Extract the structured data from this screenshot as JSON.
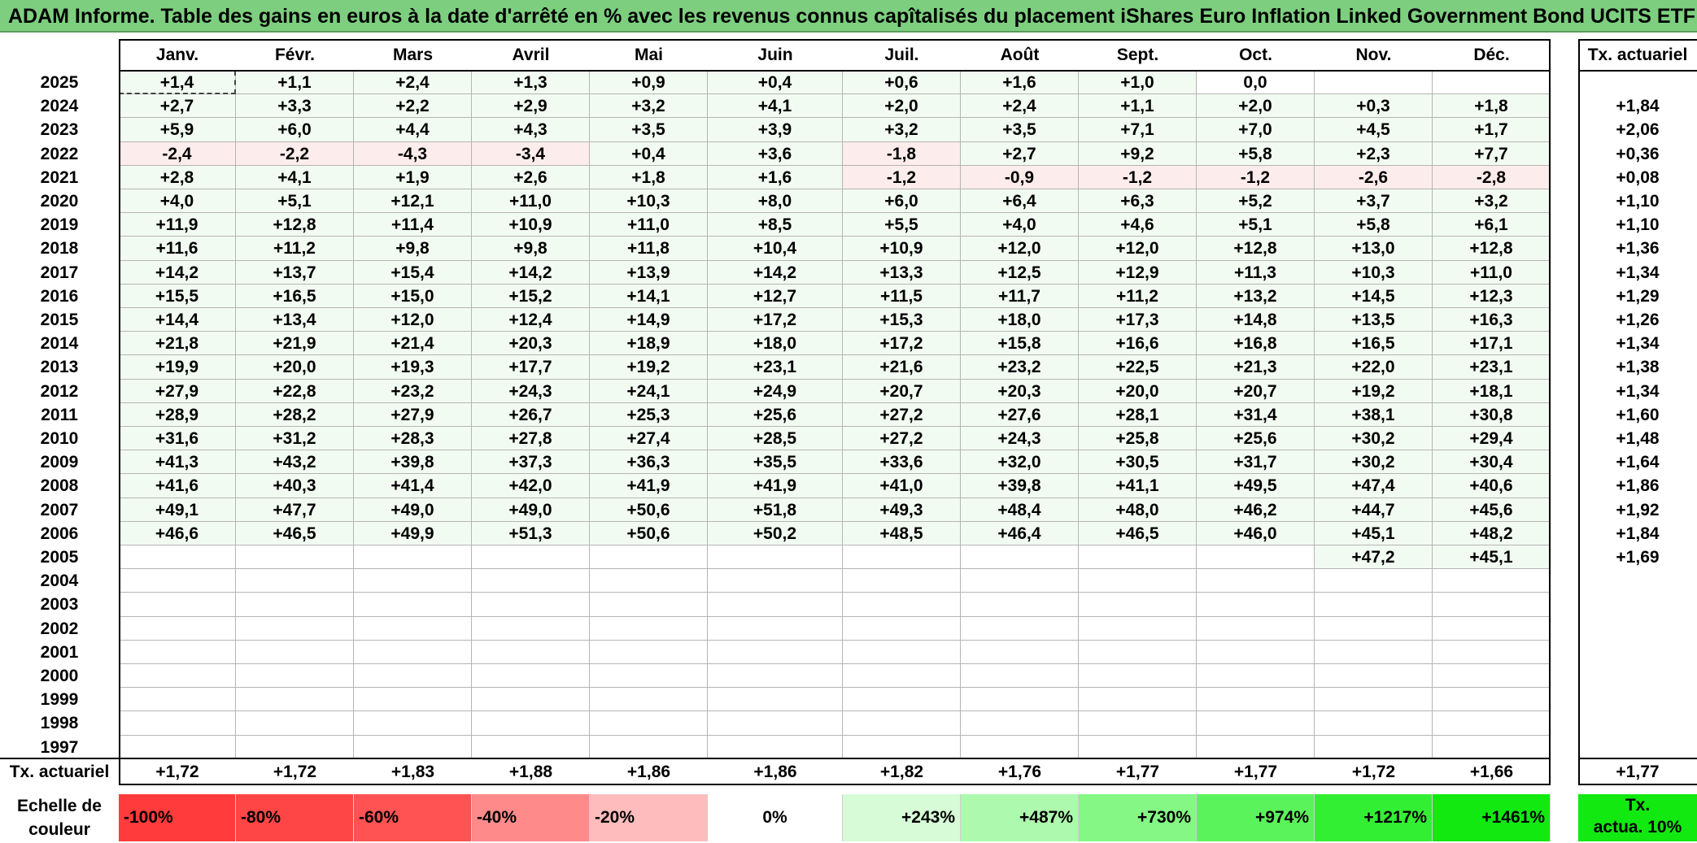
{
  "title": "ADAM Informe. Table des gains en euros à la date d'arrêté en % avec les revenus connus capîtalisés du placement iShares Euro Inflation Linked Government Bond UCITS ETF A",
  "months": [
    "Janv.",
    "Févr.",
    "Mars",
    "Avril",
    "Mai",
    "Juin",
    "Juil.",
    "Août",
    "Sept.",
    "Oct.",
    "Nov.",
    "Déc."
  ],
  "annual_header": "Tx. actuariel",
  "years": [
    "2025",
    "2024",
    "2023",
    "2022",
    "2021",
    "2020",
    "2019",
    "2018",
    "2017",
    "2016",
    "2015",
    "2014",
    "2013",
    "2012",
    "2011",
    "2010",
    "2009",
    "2008",
    "2007",
    "2006",
    "2005",
    "2004",
    "2003",
    "2002",
    "2001",
    "2000",
    "1999",
    "1998",
    "1997"
  ],
  "values": [
    [
      "+1,4",
      "+1,1",
      "+2,4",
      "+1,3",
      "+0,9",
      "+0,4",
      "+0,6",
      "+1,6",
      "+1,0",
      "0,0",
      "",
      ""
    ],
    [
      "+2,7",
      "+3,3",
      "+2,2",
      "+2,9",
      "+3,2",
      "+4,1",
      "+2,0",
      "+2,4",
      "+1,1",
      "+2,0",
      "+0,3",
      "+1,8"
    ],
    [
      "+5,9",
      "+6,0",
      "+4,4",
      "+4,3",
      "+3,5",
      "+3,9",
      "+3,2",
      "+3,5",
      "+7,1",
      "+7,0",
      "+4,5",
      "+1,7"
    ],
    [
      "-2,4",
      "-2,2",
      "-4,3",
      "-3,4",
      "+0,4",
      "+3,6",
      "-1,8",
      "+2,7",
      "+9,2",
      "+5,8",
      "+2,3",
      "+7,7"
    ],
    [
      "+2,8",
      "+4,1",
      "+1,9",
      "+2,6",
      "+1,8",
      "+1,6",
      "-1,2",
      "-0,9",
      "-1,2",
      "-1,2",
      "-2,6",
      "-2,8"
    ],
    [
      "+4,0",
      "+5,1",
      "+12,1",
      "+11,0",
      "+10,3",
      "+8,0",
      "+6,0",
      "+6,4",
      "+6,3",
      "+5,2",
      "+3,7",
      "+3,2"
    ],
    [
      "+11,9",
      "+12,8",
      "+11,4",
      "+10,9",
      "+11,0",
      "+8,5",
      "+5,5",
      "+4,0",
      "+4,6",
      "+5,1",
      "+5,8",
      "+6,1"
    ],
    [
      "+11,6",
      "+11,2",
      "+9,8",
      "+9,8",
      "+11,8",
      "+10,4",
      "+10,9",
      "+12,0",
      "+12,0",
      "+12,8",
      "+13,0",
      "+12,8"
    ],
    [
      "+14,2",
      "+13,7",
      "+15,4",
      "+14,2",
      "+13,9",
      "+14,2",
      "+13,3",
      "+12,5",
      "+12,9",
      "+11,3",
      "+10,3",
      "+11,0"
    ],
    [
      "+15,5",
      "+16,5",
      "+15,0",
      "+15,2",
      "+14,1",
      "+12,7",
      "+11,5",
      "+11,7",
      "+11,2",
      "+13,2",
      "+14,5",
      "+12,3"
    ],
    [
      "+14,4",
      "+13,4",
      "+12,0",
      "+12,4",
      "+14,9",
      "+17,2",
      "+15,3",
      "+18,0",
      "+17,3",
      "+14,8",
      "+13,5",
      "+16,3"
    ],
    [
      "+21,8",
      "+21,9",
      "+21,4",
      "+20,3",
      "+18,9",
      "+18,0",
      "+17,2",
      "+15,8",
      "+16,6",
      "+16,8",
      "+16,5",
      "+17,1"
    ],
    [
      "+19,9",
      "+20,0",
      "+19,3",
      "+17,7",
      "+19,2",
      "+23,1",
      "+21,6",
      "+23,2",
      "+22,5",
      "+21,3",
      "+22,0",
      "+23,1"
    ],
    [
      "+27,9",
      "+22,8",
      "+23,2",
      "+24,3",
      "+24,1",
      "+24,9",
      "+20,7",
      "+20,3",
      "+20,0",
      "+20,7",
      "+19,2",
      "+18,1"
    ],
    [
      "+28,9",
      "+28,2",
      "+27,9",
      "+26,7",
      "+25,3",
      "+25,6",
      "+27,2",
      "+27,6",
      "+28,1",
      "+31,4",
      "+38,1",
      "+30,8"
    ],
    [
      "+31,6",
      "+31,2",
      "+28,3",
      "+27,8",
      "+27,4",
      "+28,5",
      "+27,2",
      "+24,3",
      "+25,8",
      "+25,6",
      "+30,2",
      "+29,4"
    ],
    [
      "+41,3",
      "+43,2",
      "+39,8",
      "+37,3",
      "+36,3",
      "+35,5",
      "+33,6",
      "+32,0",
      "+30,5",
      "+31,7",
      "+30,2",
      "+30,4"
    ],
    [
      "+41,6",
      "+40,3",
      "+41,4",
      "+42,0",
      "+41,9",
      "+41,9",
      "+41,0",
      "+39,8",
      "+41,1",
      "+49,5",
      "+47,4",
      "+40,6"
    ],
    [
      "+49,1",
      "+47,7",
      "+49,0",
      "+49,0",
      "+50,6",
      "+51,8",
      "+49,3",
      "+48,4",
      "+48,0",
      "+46,2",
      "+44,7",
      "+45,6"
    ],
    [
      "+46,6",
      "+46,5",
      "+49,9",
      "+51,3",
      "+50,6",
      "+50,2",
      "+48,5",
      "+46,4",
      "+46,5",
      "+46,0",
      "+45,1",
      "+48,2"
    ],
    [
      "",
      "",
      "",
      "",
      "",
      "",
      "",
      "",
      "",
      "",
      "+47,2",
      "+45,1"
    ],
    [
      "",
      "",
      "",
      "",
      "",
      "",
      "",
      "",
      "",
      "",
      "",
      ""
    ],
    [
      "",
      "",
      "",
      "",
      "",
      "",
      "",
      "",
      "",
      "",
      "",
      ""
    ],
    [
      "",
      "",
      "",
      "",
      "",
      "",
      "",
      "",
      "",
      "",
      "",
      ""
    ],
    [
      "",
      "",
      "",
      "",
      "",
      "",
      "",
      "",
      "",
      "",
      "",
      ""
    ],
    [
      "",
      "",
      "",
      "",
      "",
      "",
      "",
      "",
      "",
      "",
      "",
      ""
    ],
    [
      "",
      "",
      "",
      "",
      "",
      "",
      "",
      "",
      "",
      "",
      "",
      ""
    ],
    [
      "",
      "",
      "",
      "",
      "",
      "",
      "",
      "",
      "",
      "",
      "",
      ""
    ],
    [
      "",
      "",
      "",
      "",
      "",
      "",
      "",
      "",
      "",
      "",
      "",
      ""
    ]
  ],
  "annual_values": [
    "",
    "+1,84",
    "+2,06",
    "+0,36",
    "+0,08",
    "+1,10",
    "+1,10",
    "+1,36",
    "+1,34",
    "+1,29",
    "+1,26",
    "+1,34",
    "+1,38",
    "+1,34",
    "+1,60",
    "+1,48",
    "+1,64",
    "+1,86",
    "+1,92",
    "+1,84",
    "+1,69",
    "",
    "",
    "",
    "",
    "",
    "",
    "",
    ""
  ],
  "footer": {
    "label": "Tx. actuariel",
    "values": [
      "+1,72",
      "+1,72",
      "+1,83",
      "+1,88",
      "+1,86",
      "+1,86",
      "+1,82",
      "+1,76",
      "+1,77",
      "+1,77",
      "+1,72",
      "+1,66"
    ],
    "total": "+1,77"
  },
  "scale": {
    "label_line1": "Echelle de",
    "label_line2": "couleur",
    "items": [
      {
        "text": "-100%",
        "color": "#ff3b3b",
        "align": "left"
      },
      {
        "text": "-80%",
        "color": "#ff4646",
        "align": "left"
      },
      {
        "text": "-60%",
        "color": "#ff5252",
        "align": "left"
      },
      {
        "text": "-40%",
        "color": "#ff8a8a",
        "align": "left"
      },
      {
        "text": "-20%",
        "color": "#ffbcbc",
        "align": "left"
      },
      {
        "text": "0%",
        "color": "#ffffff",
        "align": "center"
      },
      {
        "text": "+243%",
        "color": "#d6fbd6",
        "align": "right"
      },
      {
        "text": "+487%",
        "color": "#adf9ad",
        "align": "right"
      },
      {
        "text": "+730%",
        "color": "#84f784",
        "align": "right"
      },
      {
        "text": "+974%",
        "color": "#5bf35b",
        "align": "right"
      },
      {
        "text": "+1217%",
        "color": "#33ef33",
        "align": "right"
      },
      {
        "text": "+1461%",
        "color": "#11e911",
        "align": "right"
      }
    ],
    "annual_line1": "Tx.",
    "annual_line2": "actua. 10%",
    "annual_color": "#11e911"
  },
  "colors": {
    "title_bg": "#7dcf7f",
    "cell_positive": "#f2fbf2",
    "cell_negative": "#fdecec"
  }
}
